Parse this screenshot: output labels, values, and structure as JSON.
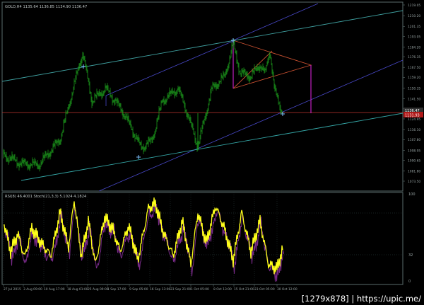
{
  "colors": {
    "background": "#000000",
    "grid": "#334a4a",
    "axis_text": "#9aa6a6",
    "candles": "#1faa1f",
    "upper_channel": "#3fa0a0",
    "mid_channel": "#4848c8",
    "lower_channel": "#34a6a6",
    "price_line": "#c0352f",
    "triangle": "#c85030",
    "magenta": "#c020c0",
    "osc_main": "#ffff1a",
    "osc_signal": "#7a2a8a",
    "marker": "#7fbfff",
    "price_tag_bg": "#b01818",
    "current_tag_bg": "#303030"
  },
  "main_panel": {
    "header": "GOLD,H4  1135.64  1136.85  1134.90  1136.47",
    "price_labels": [
      "1219.05",
      "1210.20",
      "1201.35",
      "1193.05",
      "1184.20",
      "1176.35",
      "1167.50",
      "1159.20",
      "1150.35",
      "1141.50",
      "1133.30",
      "1124.95",
      "1116.10",
      "1107.80",
      "1098.95",
      "1090.65",
      "1081.80",
      "1073.50"
    ],
    "current_price_tag": "1136.47",
    "bid_price_tag": "1131.93"
  },
  "osc_panel": {
    "header": "RSI(8) 46.4001  Stoch(21,3,3) 5.1024 4.1824",
    "levels": [
      "100",
      "32",
      "0"
    ]
  },
  "time_labels": [
    "27 Jul 2015",
    "3 Aug 09:00",
    "10 Aug 17:00",
    "18 Aug 01:00",
    "25 Aug 09:00",
    "1 Sep 17:00",
    "9 Sep 05:00",
    "16 Sep 13:00",
    "23 Sep 21:00",
    "1 Oct 05:00",
    "8 Oct 13:00",
    "15 Oct 21:00",
    "23 Oct 05:00",
    "30 Oct 12:00"
  ],
  "watermark": {
    "size_text": "[1279x878]",
    "site_text": "https://upic.me/"
  },
  "chart_data": {
    "type": "line",
    "title": "GOLD,H4",
    "x": [
      "27 Jul 2015",
      "3 Aug 09:00",
      "10 Aug 17:00",
      "18 Aug 01:00",
      "25 Aug 09:00",
      "1 Sep 17:00",
      "9 Sep 05:00",
      "16 Sep 13:00",
      "23 Sep 21:00",
      "1 Oct 05:00",
      "8 Oct 13:00",
      "15 Oct 21:00",
      "23 Oct 05:00",
      "30 Oct 12:00"
    ],
    "series": [
      {
        "name": "GOLD,H4",
        "values": [
          1096,
          1092,
          1117,
          1157,
          1137,
          1136,
          1106,
          1116,
          1133,
          1115,
          1139,
          1184,
          1165,
          1141
        ]
      },
      {
        "name": "RSI(8)",
        "values": [
          62,
          42,
          75,
          95,
          30,
          52,
          35,
          48,
          72,
          20,
          88,
          78,
          40,
          46
        ]
      }
    ],
    "ylim": [
      1073.5,
      1219.05
    ],
    "grid": true
  }
}
